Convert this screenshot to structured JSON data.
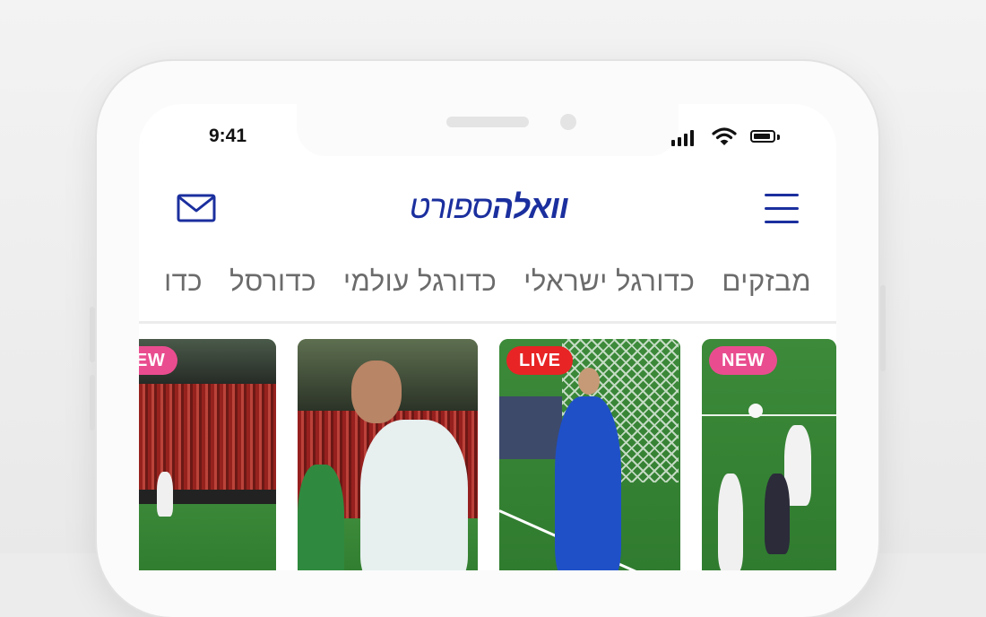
{
  "status_bar": {
    "time": "9:41"
  },
  "header": {
    "logo_bold": "וואלה",
    "logo_light": "ספורט"
  },
  "tabs": [
    "מבזקים",
    "כדורגל ישראלי",
    "כדורגל עולמי",
    "כדורסל",
    "כדו"
  ],
  "stories": [
    {
      "badge": "NEW",
      "badge_color": "#e94d8f"
    },
    {
      "badge": "LIVE",
      "badge_color": "#e82424"
    },
    {
      "badge": "",
      "badge_color": ""
    },
    {
      "badge": "EW",
      "badge_color": "#e94d8f"
    }
  ],
  "colors": {
    "brand": "#1b2f9e",
    "tab_text": "#6b6b6b",
    "new_badge": "#e94d8f",
    "live_badge": "#e82424"
  },
  "icons": {
    "menu": "hamburger-icon",
    "mail": "envelope-icon",
    "signal": "cellular-signal-icon",
    "wifi": "wifi-icon",
    "battery": "battery-icon"
  }
}
